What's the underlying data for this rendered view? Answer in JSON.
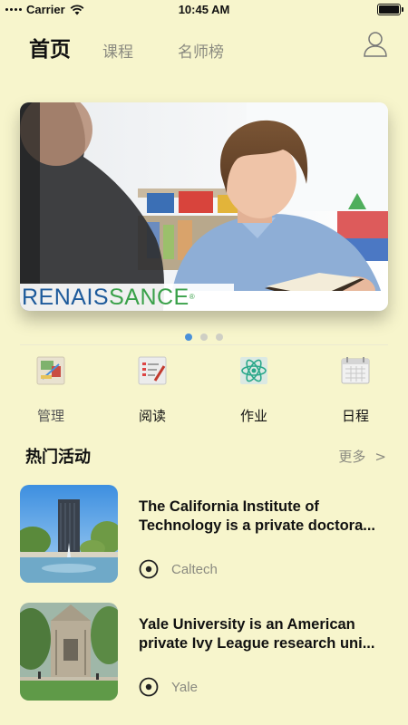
{
  "status_bar": {
    "carrier": "Carrier",
    "time": "10:45 AM",
    "battery_level": 1.0
  },
  "header": {
    "tabs": [
      {
        "label": "首页",
        "active": true
      },
      {
        "label": "课程",
        "active": false
      },
      {
        "label": "名师榜",
        "active": false
      }
    ],
    "user_icon": "user-icon"
  },
  "banner": {
    "brand_part1": "RENAIS",
    "brand_part2": "SANCE",
    "brand_mark": "®",
    "page_count": 3,
    "active_page": 1
  },
  "quick_menu": [
    {
      "label": "管理",
      "icon": "manage-icon"
    },
    {
      "label": "阅读",
      "icon": "reading-icon"
    },
    {
      "label": "作业",
      "icon": "homework-icon"
    },
    {
      "label": "日程",
      "icon": "calendar-icon"
    }
  ],
  "section": {
    "title": "热门活动",
    "more": "更多",
    "more_chevron": ">"
  },
  "activities": [
    {
      "title_line1": "The California Institute of",
      "title_line2": "Technology is a private doctora...",
      "tag": "Caltech"
    },
    {
      "title_line1": "Yale University is an American",
      "title_line2": "private Ivy League research uni...",
      "tag": "Yale"
    }
  ],
  "colors": {
    "background": "#f7f5cc",
    "accent": "#4a90d9",
    "muted": "#8a8a80"
  }
}
